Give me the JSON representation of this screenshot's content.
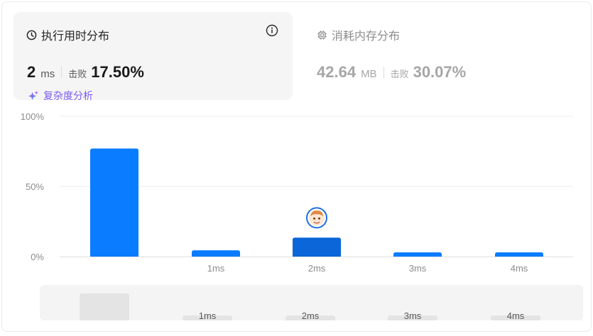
{
  "runtime_card": {
    "title": "执行用时分布",
    "value": "2",
    "unit": "ms",
    "beats_label": "击败",
    "beats_value": "17.50%",
    "analysis_label": "复杂度分析"
  },
  "memory_card": {
    "title": "消耗内存分布",
    "value": "42.64",
    "unit": "MB",
    "beats_label": "击败",
    "beats_value": "30.07%"
  },
  "colors": {
    "bar": "#0a7cff",
    "bar_selected": "#0a66d9",
    "analysis": "#7b5cf0",
    "card_bg": "#f5f5f5"
  },
  "chart_data": {
    "type": "bar",
    "categories": [
      "",
      "1ms",
      "2ms",
      "3ms",
      "4ms"
    ],
    "values": [
      77,
      4.5,
      13.5,
      3,
      3
    ],
    "selected_index": 2,
    "y_ticks": [
      "100%",
      "50%",
      "0%"
    ],
    "ylim": [
      0,
      100
    ],
    "grid": true
  },
  "navigator": {
    "labels": [
      "1ms",
      "2ms",
      "3ms",
      "4ms"
    ]
  }
}
